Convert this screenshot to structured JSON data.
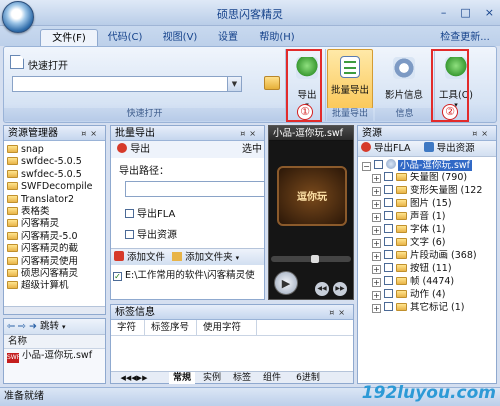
{
  "window": {
    "title": "硕思闪客精灵",
    "controls": [
      "–",
      "□",
      "×"
    ]
  },
  "menu": {
    "tabs": [
      "文件(F)",
      "代码(C)",
      "视图(V)",
      "设置",
      "帮助(H)"
    ],
    "check_update": "检查更新..."
  },
  "ribbon": {
    "quick_open": {
      "label": "快速打开",
      "group": "快速打开",
      "value": ""
    },
    "export": {
      "label": "导出",
      "marker": "①"
    },
    "batch_export": {
      "label": "批量导出",
      "group": "批量导出"
    },
    "movie_info": {
      "label": "影片信息"
    },
    "info_group": "信息",
    "tools": {
      "label": "工具(O)",
      "marker": "②"
    }
  },
  "resource_manager": {
    "title": "资源管理器",
    "items": [
      "snap",
      "swfdec-5.0.5",
      "swfdec-5.0.5",
      "SWFDecompile",
      "Translator2",
      "表格类",
      "闪客精灵",
      "闪客精灵-5.0",
      "闪客精灵的截",
      "闪客精灵使用",
      "硕思闪客精灵",
      "超级计算机"
    ],
    "nav": {
      "jump": "跳转"
    },
    "list_header": "名称",
    "file": "小品-逗你玩.swf"
  },
  "batch_panel": {
    "title": "批量导出",
    "export_btn": "导出",
    "select_all": "选中",
    "path_label": "导出路径：",
    "path_value": "",
    "export_fla": "导出FLA",
    "export_resources": "导出资源",
    "add_file": "添加文件",
    "add_folder": "添加文件夹",
    "file_path": "E:\\工作常用的软件\\闪客精灵使"
  },
  "preview": {
    "title": "小品-逗你玩.swf",
    "subtitle": "逗你玩"
  },
  "resources": {
    "title": "资源",
    "export_fla": "导出FLA",
    "export_resources": "导出资源",
    "root": "小品-逗你玩.swf",
    "items": [
      {
        "label": "矢量图",
        "count": "(790)"
      },
      {
        "label": "变形矢量图",
        "count": "(122"
      },
      {
        "label": "图片",
        "count": "(15)"
      },
      {
        "label": "声音",
        "count": "(1)"
      },
      {
        "label": "字体",
        "count": "(1)"
      },
      {
        "label": "文字",
        "count": "(6)"
      },
      {
        "label": "片段动画",
        "count": "(368)"
      },
      {
        "label": "按钮",
        "count": "(11)"
      },
      {
        "label": "帧",
        "count": "(4474)"
      },
      {
        "label": "动作",
        "count": "(4)"
      },
      {
        "label": "其它标记",
        "count": "(1)"
      }
    ]
  },
  "tag_info": {
    "title": "标签信息",
    "columns": [
      "字符",
      "标签序号",
      "使用字符"
    ]
  },
  "bottom_tabs": [
    "常規",
    "实例",
    "标签",
    "组件",
    "6进制"
  ],
  "status": "准备就绪",
  "watermark": "192luyou.com"
}
